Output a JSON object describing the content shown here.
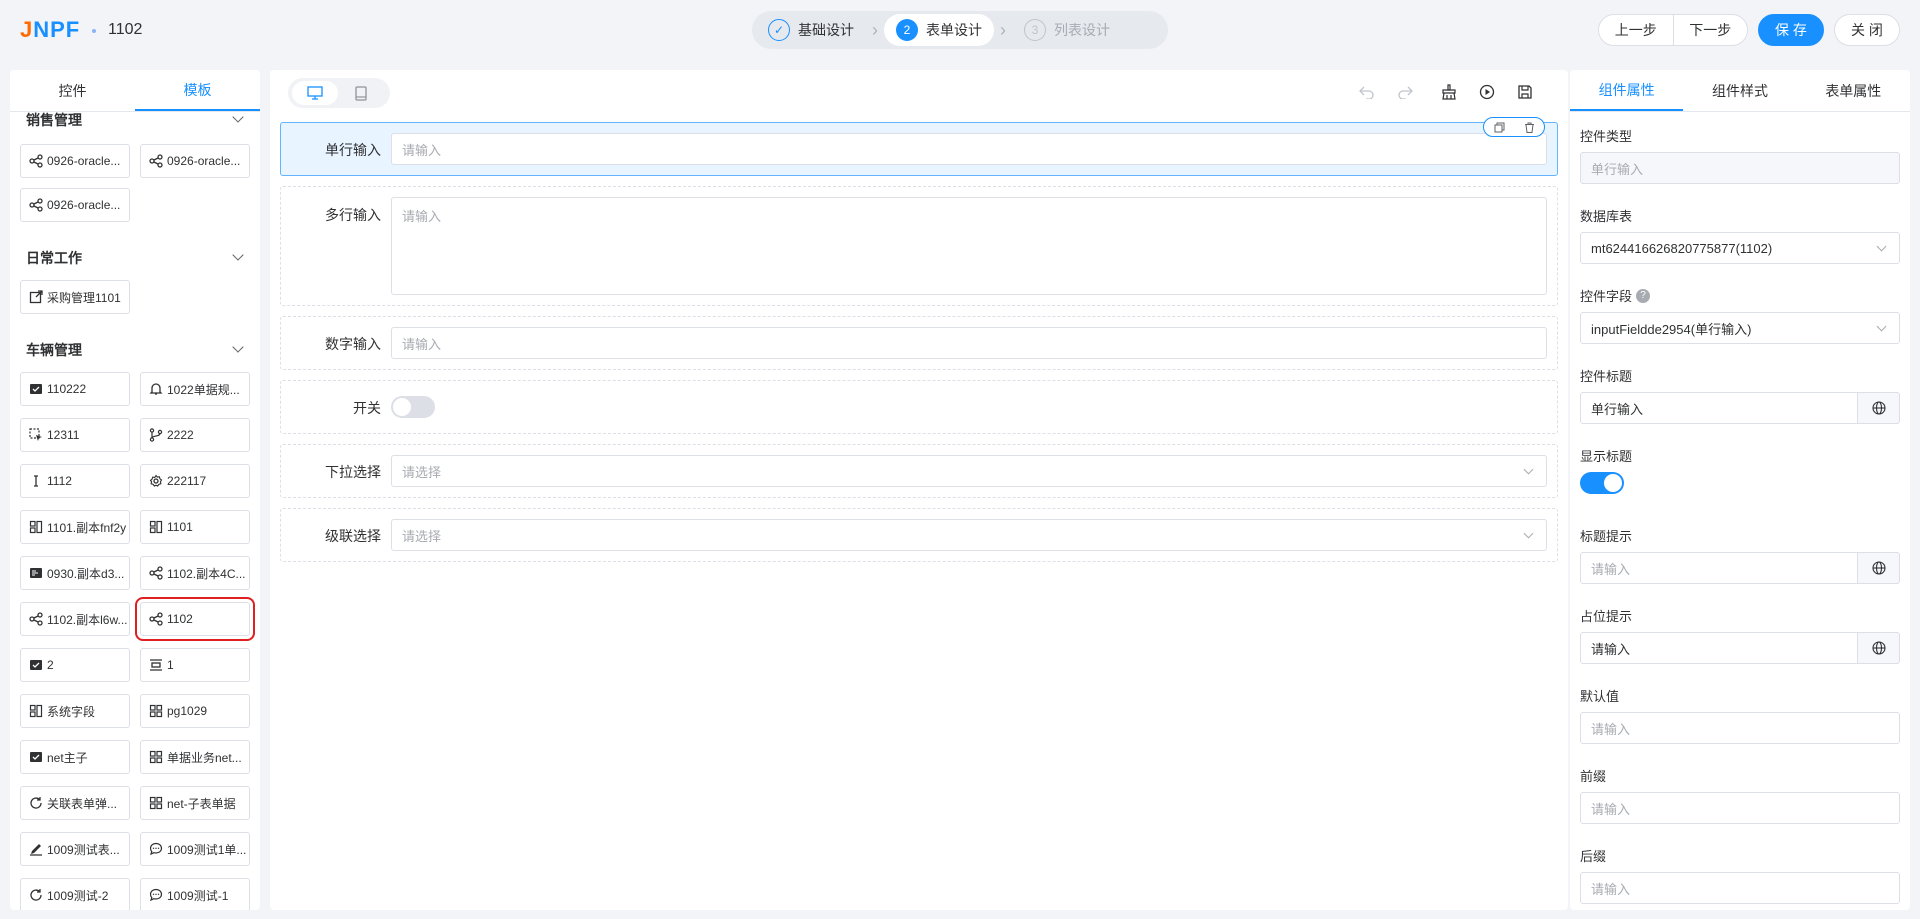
{
  "header": {
    "logo": "JNPF",
    "title": "1102",
    "steps": [
      {
        "num": "✓",
        "label": "基础设计"
      },
      {
        "num": "2",
        "label": "表单设计"
      },
      {
        "num": "3",
        "label": "列表设计"
      }
    ],
    "prev_label": "上一步",
    "next_label": "下一步",
    "save_label": "保 存",
    "close_label": "关 闭"
  },
  "left": {
    "tabs": [
      "控件",
      "模板"
    ],
    "groups": [
      {
        "title": "销售管理"
      },
      {
        "title": "日常工作"
      },
      {
        "title": "车辆管理"
      }
    ],
    "items": [
      {
        "label": "0926-oracle...",
        "icon": "share-nodes-icon"
      },
      {
        "label": "0926-oracle...",
        "icon": "share-nodes-icon"
      },
      {
        "label": "0926-oracle...",
        "icon": "share-nodes-icon"
      },
      {
        "label": "采购管理1101",
        "icon": "external-link-icon"
      },
      {
        "label": "110222",
        "icon": "archive-icon"
      },
      {
        "label": "1022单据规...",
        "icon": "bell-icon"
      },
      {
        "label": "12311",
        "icon": "select-cursor-icon"
      },
      {
        "label": "2222",
        "icon": "git-branch-icon"
      },
      {
        "label": "1112",
        "icon": "text-cursor-icon"
      },
      {
        "label": "222117",
        "icon": "gear-icon"
      },
      {
        "label": "1101.副本fnf2y",
        "icon": "layout-grid-icon"
      },
      {
        "label": "1101",
        "icon": "layout-grid-icon"
      },
      {
        "label": "0930.副本d3...",
        "icon": "id-card-icon"
      },
      {
        "label": "1102.副本4C...",
        "icon": "share-nodes-icon"
      },
      {
        "label": "1102.副本l6w...",
        "icon": "share-nodes-icon"
      },
      {
        "label": "1102",
        "icon": "share-nodes-icon"
      },
      {
        "label": "2",
        "icon": "archive-icon"
      },
      {
        "label": "1",
        "icon": "align-center-icon"
      },
      {
        "label": "系统字段",
        "icon": "layout-grid-icon"
      },
      {
        "label": "pg1029",
        "icon": "grid-four-icon"
      },
      {
        "label": "net主子",
        "icon": "archive-icon"
      },
      {
        "label": "单据业务net...",
        "icon": "grid-four-icon"
      },
      {
        "label": "关联表单弹...",
        "icon": "refresh-icon"
      },
      {
        "label": "net-子表单据",
        "icon": "grid-four-icon"
      },
      {
        "label": "1009测试表...",
        "icon": "pen-icon"
      },
      {
        "label": "1009测试1单...",
        "icon": "chat-icon"
      },
      {
        "label": "1009测试-2",
        "icon": "refresh-icon"
      },
      {
        "label": "1009测试-1",
        "icon": "chat-icon"
      }
    ]
  },
  "canvas": {
    "fields": [
      {
        "label": "单行输入",
        "placeholder": "请输入"
      },
      {
        "label": "多行输入",
        "placeholder": "请输入"
      },
      {
        "label": "数字输入",
        "placeholder": "请输入"
      },
      {
        "label": "开关",
        "placeholder": ""
      },
      {
        "label": "下拉选择",
        "placeholder": "请选择"
      },
      {
        "label": "级联选择",
        "placeholder": "请选择"
      }
    ]
  },
  "right": {
    "tabs": [
      "组件属性",
      "组件样式",
      "表单属性"
    ],
    "props": {
      "type_label": "控件类型",
      "type_value": "单行输入",
      "table_label": "数据库表",
      "table_value": "mt624416626820775877(1102)",
      "field_label": "控件字段",
      "field_value": "inputFieldde2954(单行输入)",
      "title_label": "控件标题",
      "title_value": "单行输入",
      "show_title_label": "显示标题",
      "title_tip_label": "标题提示",
      "title_tip_ph": "请输入",
      "placeholder_label": "占位提示",
      "placeholder_value": "请输入",
      "default_label": "默认值",
      "default_ph": "请输入",
      "prefix_label": "前缀",
      "prefix_ph": "请输入",
      "suffix_label": "后缀",
      "suffix_ph": "请输入"
    }
  },
  "colors": {
    "primary": "#1890ff",
    "highlight": "#e02020"
  }
}
